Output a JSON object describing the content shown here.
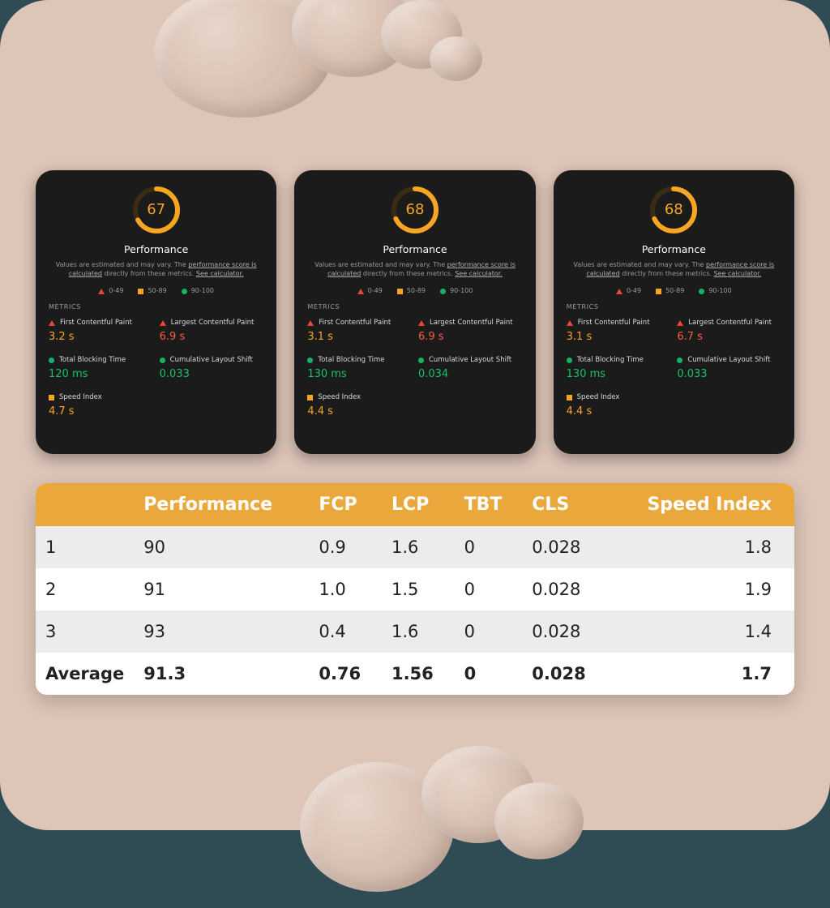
{
  "colors": {
    "orange": "#f6a623",
    "red": "#f04438",
    "green": "#17b26a"
  },
  "lighthouse": {
    "title": "Performance",
    "description_prefix": "Values are estimated and may vary. The ",
    "link1": "performance score is calculated",
    "description_mid": " directly from these metrics. ",
    "link2": "See calculator.",
    "legend": {
      "poor": "0-49",
      "mid": "50-89",
      "good": "90-100"
    },
    "metrics_label": "METRICS",
    "metric_names": {
      "fcp": "First Contentful Paint",
      "lcp": "Largest Contentful Paint",
      "tbt": "Total Blocking Time",
      "cls": "Cumulative Layout Shift",
      "si": "Speed Index"
    }
  },
  "cards": [
    {
      "score": "67",
      "fcp": "3.2 s",
      "lcp": "6.9 s",
      "tbt": "120 ms",
      "cls": "0.033",
      "si": "4.7 s"
    },
    {
      "score": "68",
      "fcp": "3.1 s",
      "lcp": "6.9 s",
      "tbt": "130 ms",
      "cls": "0.034",
      "si": "4.4 s"
    },
    {
      "score": "68",
      "fcp": "3.1 s",
      "lcp": "6.7 s",
      "tbt": "130 ms",
      "cls": "0.033",
      "si": "4.4 s"
    }
  ],
  "table": {
    "headers": {
      "idx": "",
      "perf": "Performance",
      "fcp": "FCP",
      "lcp": "LCP",
      "tbt": "TBT",
      "cls": "CLS",
      "si": "Speed Index"
    },
    "rows": [
      {
        "idx": "1",
        "perf": "90",
        "fcp": "0.9",
        "lcp": "1.6",
        "tbt": "0",
        "cls": "0.028",
        "si": "1.8"
      },
      {
        "idx": "2",
        "perf": "91",
        "fcp": "1.0",
        "lcp": "1.5",
        "tbt": "0",
        "cls": "0.028",
        "si": "1.9"
      },
      {
        "idx": "3",
        "perf": "93",
        "fcp": "0.4",
        "lcp": "1.6",
        "tbt": "0",
        "cls": "0.028",
        "si": "1.4"
      }
    ],
    "average": {
      "label": "Average",
      "perf": "91.3",
      "fcp": "0.76",
      "lcp": "1.56",
      "tbt": "0",
      "cls": "0.028",
      "si": "1.7"
    }
  },
  "chart_data": [
    {
      "type": "pie",
      "title": "Performance",
      "values": [
        67,
        33
      ],
      "categories": [
        "score",
        "remaining"
      ],
      "ylim": [
        0,
        100
      ]
    },
    {
      "type": "pie",
      "title": "Performance",
      "values": [
        68,
        32
      ],
      "categories": [
        "score",
        "remaining"
      ],
      "ylim": [
        0,
        100
      ]
    },
    {
      "type": "pie",
      "title": "Performance",
      "values": [
        68,
        32
      ],
      "categories": [
        "score",
        "remaining"
      ],
      "ylim": [
        0,
        100
      ]
    },
    {
      "type": "table",
      "title": "Performance metrics summary",
      "columns": [
        "",
        "Performance",
        "FCP",
        "LCP",
        "TBT",
        "CLS",
        "Speed Index"
      ],
      "rows": [
        [
          "1",
          90,
          0.9,
          1.6,
          0,
          0.028,
          1.8
        ],
        [
          "2",
          91,
          1.0,
          1.5,
          0,
          0.028,
          1.9
        ],
        [
          "3",
          93,
          0.4,
          1.6,
          0,
          0.028,
          1.4
        ],
        [
          "Average",
          91.3,
          0.76,
          1.56,
          0,
          0.028,
          1.7
        ]
      ]
    }
  ]
}
